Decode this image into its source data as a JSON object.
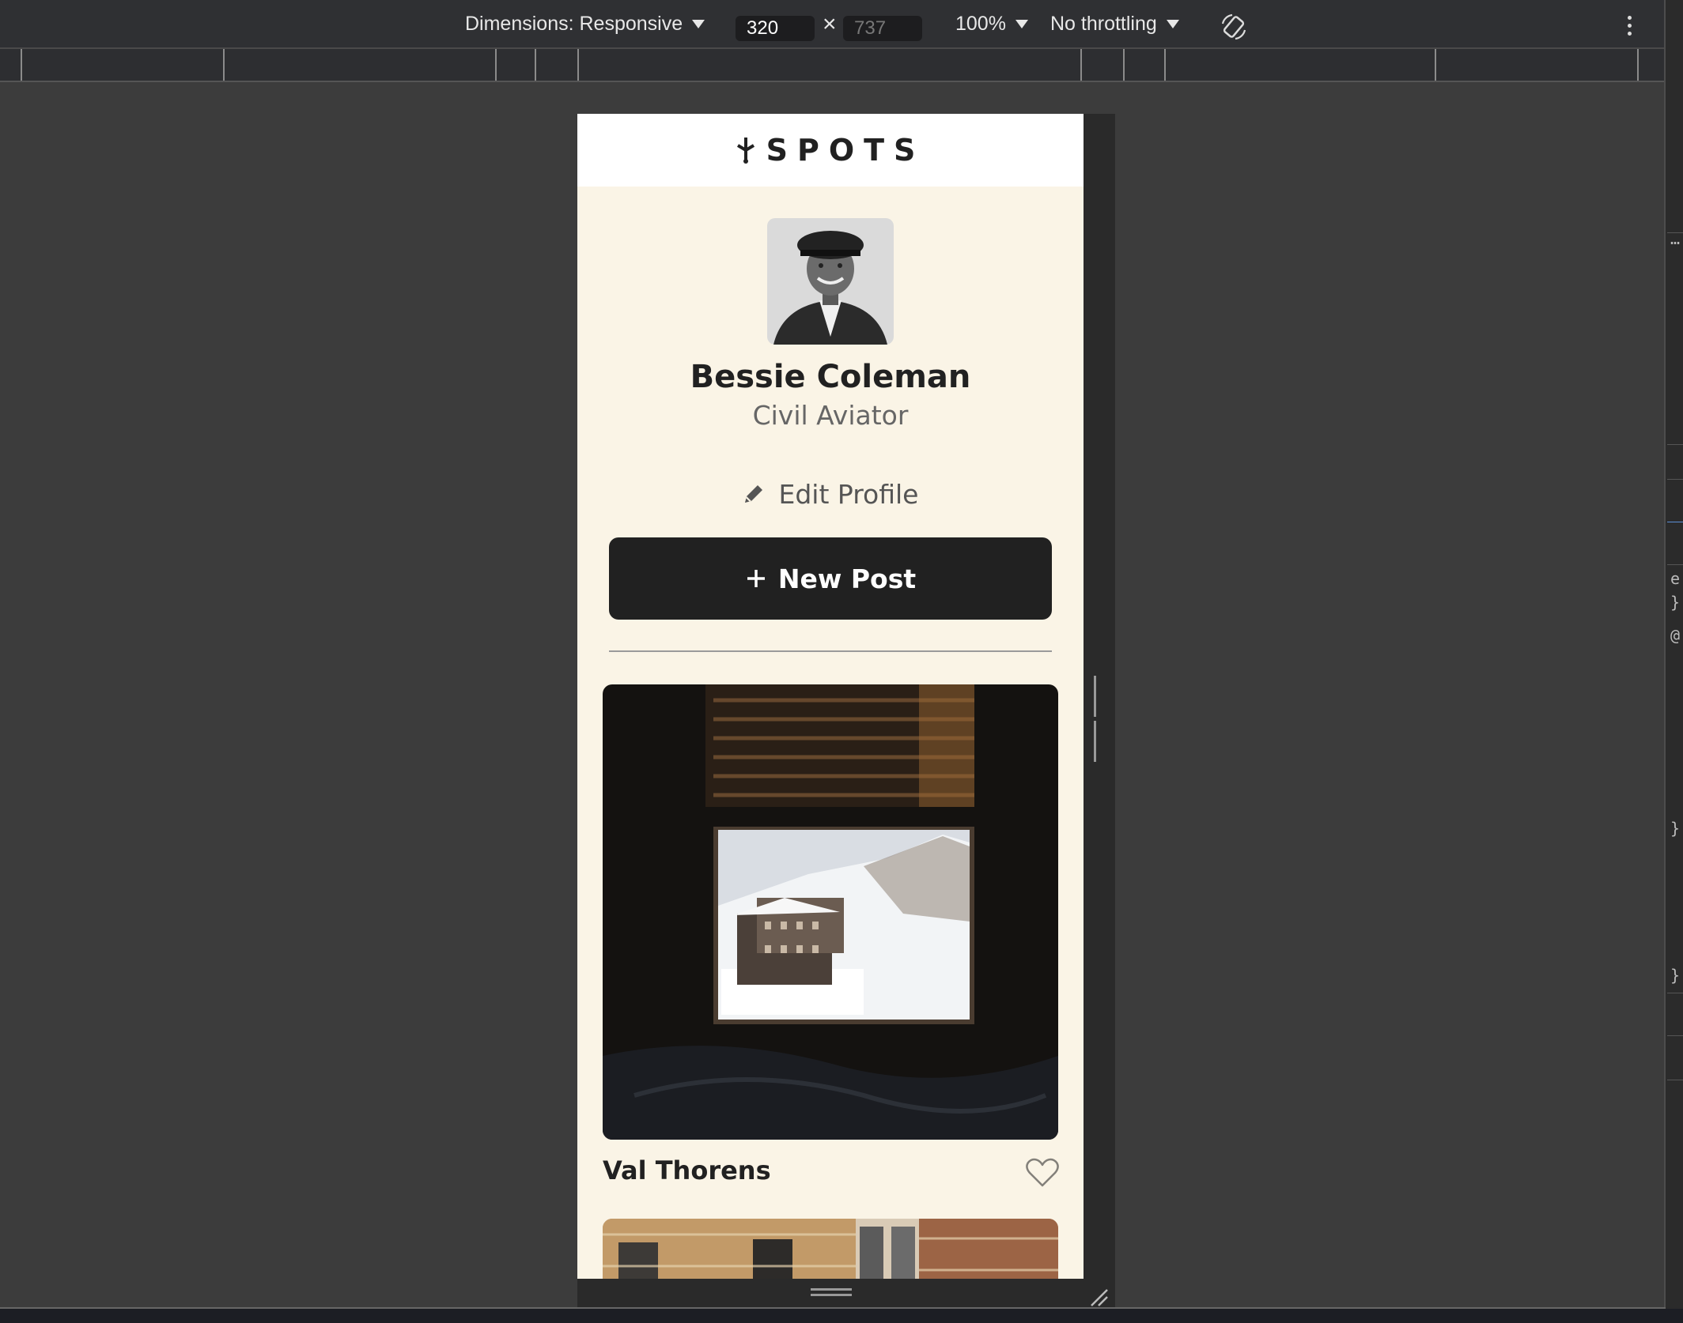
{
  "devtools": {
    "dimensions_label": "Dimensions: Responsive",
    "width_value": "320",
    "height_value": "737",
    "times_symbol": "×",
    "zoom_label": "100%",
    "throttling_label": "No throttling",
    "icons": [
      "rotate-icon",
      "kebab-menu-icon"
    ]
  },
  "site": {
    "logo_text": "SPOTS",
    "profile": {
      "name": "Bessie Coleman",
      "description": "Civil Aviator",
      "edit_label": "Edit Profile",
      "new_post_label": "New Post"
    },
    "cards": [
      {
        "title": "Val Thorens",
        "liked": false
      },
      {
        "title": ""
      }
    ]
  },
  "colors": {
    "page_bg": "#faf4e6",
    "header_bg": "#ffffff",
    "text_dark": "#212121",
    "button_bg": "#212121",
    "devtools_bg": "#3c3c3c"
  }
}
